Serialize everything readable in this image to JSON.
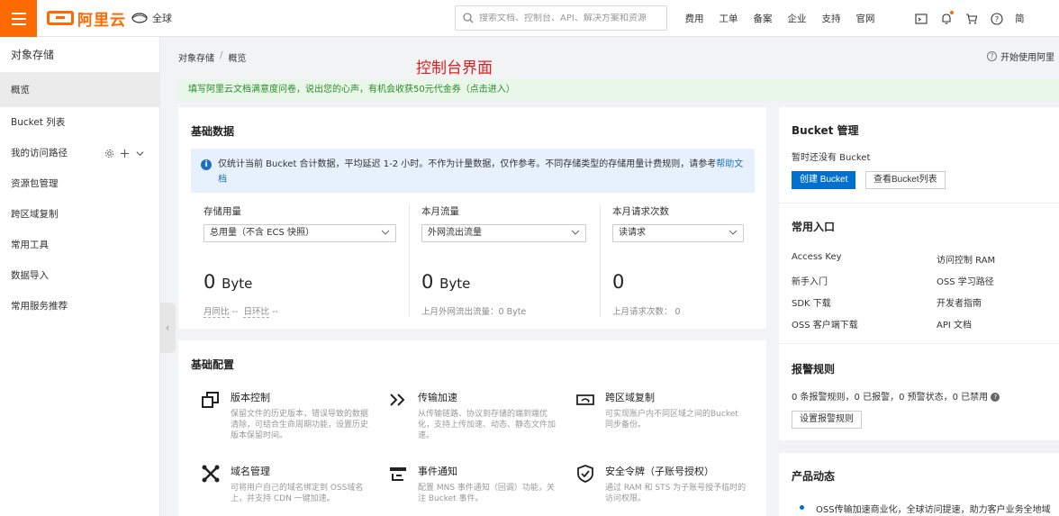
{
  "topbar": {
    "logo_text": "阿里云",
    "region": "全球",
    "search_placeholder": "搜索文档、控制台、API、解决方案和资源",
    "nav": [
      "费用",
      "工单",
      "备案",
      "企业",
      "支持",
      "官网"
    ],
    "nav_cut": "简"
  },
  "sidebar": {
    "title": "对象存储",
    "items": [
      "概览",
      "Bucket 列表",
      "我的访问路径",
      "资源包管理",
      "跨区域复制",
      "常用工具",
      "数据导入",
      "常用服务推荐"
    ]
  },
  "breadcrumb": {
    "root": "对象存储",
    "sep": "/",
    "current": "概览"
  },
  "overlay_label": "控制台界面",
  "help_link": "开始使用阿里",
  "notice": {
    "text": "填写阿里云文档满意度问卷，说出您的心声，有机会收获50元代金券（",
    "link": "点击进入",
    "tail": "）"
  },
  "basic": {
    "title": "基础数据",
    "info": "仅统计当前 Bucket 合计数据，平均延迟 1-2 小时。不作为计量数据，仅作参考。不同存储类型的存储用量计费规则，请参考",
    "info_link": "帮助文档",
    "metrics": [
      {
        "label": "存储用量",
        "select": "总用量（不含 ECS 快照）",
        "value": "0",
        "unit": "Byte",
        "sub_a": "月同比",
        "sub_a_val": "--",
        "sub_b": "日环比",
        "sub_b_val": "--"
      },
      {
        "label": "本月流量",
        "select": "外网流出流量",
        "value": "0",
        "unit": "Byte",
        "sub": "上月外网流出流量：0 Byte"
      },
      {
        "label": "本月请求次数",
        "select": "读请求",
        "value": "0",
        "unit": "",
        "sub": "上月请求次数：  0"
      }
    ]
  },
  "config": {
    "title": "基础配置",
    "features": [
      {
        "name": "版本控制",
        "desc": "保留文件的历史版本，错误导致的数据清除，可结合生命周期功能，设置历史版本保留时间。"
      },
      {
        "name": "传输加速",
        "desc": "从传输链路、协议到存储的端到端优化，支持上传加速、动态、静态文件加速。"
      },
      {
        "name": "跨区域复制",
        "desc": "可实现账户内不同区域之间的Bucket 同步备份。"
      },
      {
        "name": "域名管理",
        "desc": "可将用户自己的域名绑定到 OSS域名上，并支持 CDN 一键加速。"
      },
      {
        "name": "事件通知",
        "desc": "配置 MNS 事件通知（回调）功能，关注 Bucket 事件。"
      },
      {
        "name": "安全令牌（子账号授权）",
        "desc": "通过 RAM 和 STS 为子账号授予临时的访问权限。"
      }
    ]
  },
  "bucket_mgmt": {
    "title": "Bucket 管理",
    "empty": "暂时还没有 Bucket",
    "create": "创建 Bucket",
    "list": "查看Bucket列表"
  },
  "entries": {
    "title": "常用入口",
    "left": [
      "Access Key",
      "新手入门",
      "SDK 下载",
      "OSS 客户端下载"
    ],
    "right": [
      "访问控制 RAM",
      "OSS 学习路径",
      "开发者指南",
      "API 文档"
    ]
  },
  "alarm": {
    "title": "报警规则",
    "summary": "0 条报警规则，0 已报警，0 预警状态，0 已禁用",
    "button": "设置报警规则"
  },
  "news": {
    "title": "产品动态",
    "item": "OSS传输加速商业化，全球访问提速，助力客户业务全地域"
  },
  "colors": {
    "brand": "#ff6a00",
    "primary": "#0070cc",
    "notice_bg": "#e8f7e8",
    "info_bg": "#e6f1fc"
  }
}
